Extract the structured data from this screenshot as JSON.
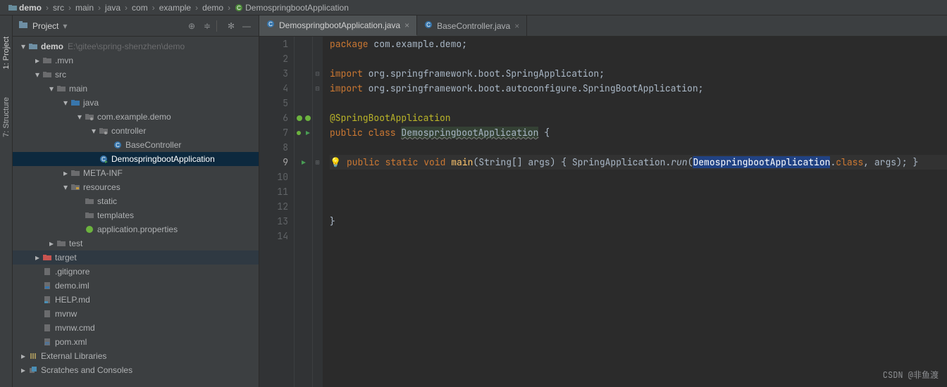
{
  "breadcrumb": {
    "items": [
      "demo",
      "src",
      "main",
      "java",
      "com",
      "example",
      "demo",
      "DemospringbootApplication"
    ]
  },
  "toolstrip": {
    "project": "1: Project",
    "structure": "7: Structure"
  },
  "sidebar": {
    "title": "Project"
  },
  "tree": {
    "demo": "demo",
    "demoPath": "E:\\gitee\\spring-shenzhen\\demo",
    "mvn": ".mvn",
    "src": "src",
    "main": "main",
    "java": "java",
    "pkg": "com.example.demo",
    "controller": "controller",
    "baseController": "BaseController",
    "app": "DemospringbootApplication",
    "metaInf": "META-INF",
    "resources": "resources",
    "static": "static",
    "templates": "templates",
    "appProps": "application.properties",
    "test": "test",
    "target": "target",
    "gitignore": ".gitignore",
    "demoIml": "demo.iml",
    "help": "HELP.md",
    "mvnw": "mvnw",
    "mvnwcmd": "mvnw.cmd",
    "pom": "pom.xml",
    "extLib": "External Libraries",
    "scratches": "Scratches and Consoles"
  },
  "tabs": [
    {
      "label": "DemospringbootApplication.java",
      "active": true
    },
    {
      "label": "BaseController.java",
      "active": false
    }
  ],
  "code": {
    "l1_kw": "package",
    "l1_pkg": " com.example.demo;",
    "l3_kw": "import",
    "l3_pkg": " org.springframework.boot.SpringApplication;",
    "l4_kw": "import",
    "l4_pkg": " org.springframework.boot.autoconfigure.SpringBootApplication;",
    "l6_ann": "@SpringBootApplication",
    "l7_pub": "public class ",
    "l7_cls": "DemospringbootApplication",
    "l7_brace": " {",
    "l9_lead": "    ",
    "l9_pub": "public static void ",
    "l9_fn": "main",
    "l9_args": "(String[] args) { ",
    "l9_call": "SpringApplication.",
    "l9_run": "run",
    "l9_open": "(",
    "l9_sel": "DemospringbootApplication",
    "l9_rest": ".",
    "l9_class": "class",
    "l9_end": ", args); }",
    "l13_brace": "}"
  },
  "lineNumbers": [
    "1",
    "2",
    "3",
    "4",
    "5",
    "6",
    "7",
    "8",
    "9",
    "10",
    "11",
    "12",
    "13",
    "14"
  ],
  "watermark": "CSDN @非鱼渡"
}
